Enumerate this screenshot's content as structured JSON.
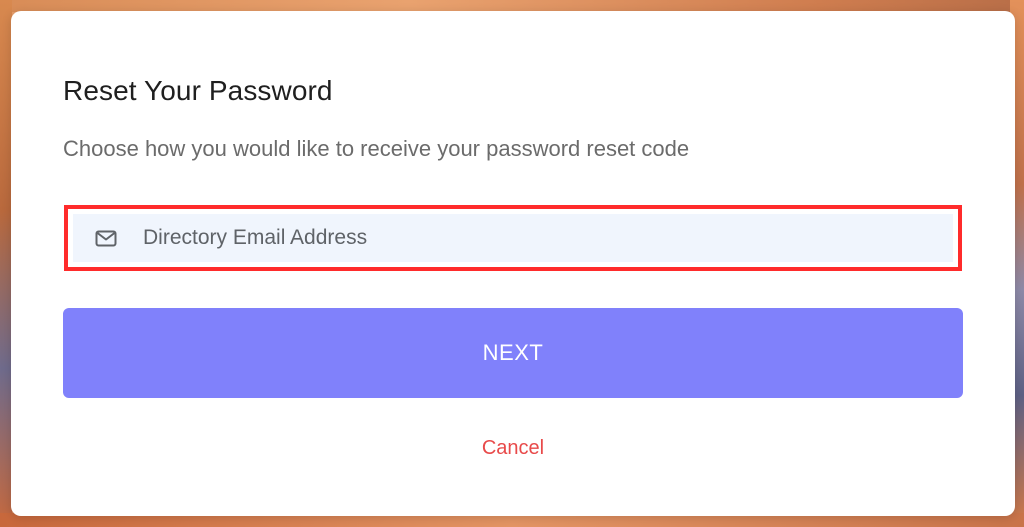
{
  "dialog": {
    "title": "Reset Your Password",
    "subtitle": "Choose how you would like to receive your password reset code",
    "option": {
      "label": "Directory Email Address",
      "icon": "mail-icon"
    },
    "next_label": "NEXT",
    "cancel_label": "Cancel"
  },
  "colors": {
    "primary": "#8081fb",
    "highlight": "#ff2b2b",
    "cancel": "#e84a4a",
    "option_bg": "#f0f5fd"
  }
}
